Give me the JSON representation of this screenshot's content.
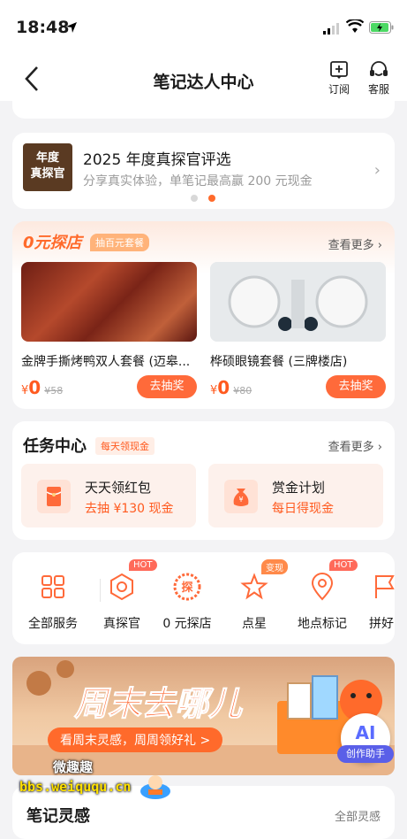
{
  "status": {
    "time": "18:48"
  },
  "nav": {
    "title": "笔记达人中心",
    "subscribe": "订阅",
    "service": "客服"
  },
  "banner": {
    "badge": [
      "年度",
      "真探官"
    ],
    "title": "2025 年度真探官评选",
    "subtitle": "分享真实体验，单笔记最高赢 200 元现金"
  },
  "free_explore": {
    "title": "0元探店",
    "tag": "抽百元套餐",
    "more": "查看更多",
    "items": [
      {
        "name": "金牌手撕烤鸭双人套餐 (迈皋...",
        "currency": "¥",
        "price": "0",
        "original": "¥58",
        "button": "去抽奖"
      },
      {
        "name": "桦硕眼镜套餐 (三牌楼店)",
        "currency": "¥",
        "price": "0",
        "original": "¥80",
        "button": "去抽奖"
      }
    ]
  },
  "tasks": {
    "title": "任务中心",
    "tag": "每天领现金",
    "more": "查看更多",
    "items": [
      {
        "name": "天天领红包",
        "sub": "去抽 ¥130 现金"
      },
      {
        "name": "赏金计划",
        "sub": "每日得现金"
      }
    ]
  },
  "services": {
    "items": [
      {
        "label": "全部服务",
        "badge": ""
      },
      {
        "label": "真探官",
        "badge": "HOT"
      },
      {
        "label": "0 元探店",
        "badge": ""
      },
      {
        "label": "点星",
        "badge": "变现"
      },
      {
        "label": "地点标记",
        "badge": "HOT"
      },
      {
        "label": "拼好",
        "badge": ""
      }
    ]
  },
  "promo": {
    "title": "周末去哪儿",
    "subtitle": "看周末灵感，周周领好礼 >"
  },
  "ai": {
    "icon": "AI",
    "label": "创作助手"
  },
  "peek": {
    "title": "笔记灵感",
    "more": "全部灵感"
  },
  "watermark": {
    "line1": "微趣趣",
    "line2": "bbs.weiququ.cn"
  },
  "colors": {
    "accent": "#ff5a1f",
    "background": "#f3f3f5"
  }
}
